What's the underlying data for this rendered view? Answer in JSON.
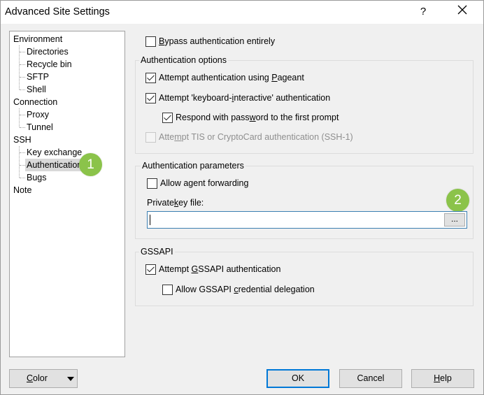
{
  "window": {
    "title": "Advanced Site Settings",
    "help_glyph": "?",
    "close_glyph": "close"
  },
  "tree": {
    "items": [
      {
        "label": "Environment"
      },
      {
        "label": "Directories"
      },
      {
        "label": "Recycle bin"
      },
      {
        "label": "SFTP"
      },
      {
        "label": "Shell"
      },
      {
        "label": "Connection"
      },
      {
        "label": "Proxy"
      },
      {
        "label": "Tunnel"
      },
      {
        "label": "SSH"
      },
      {
        "label": "Key exchange"
      },
      {
        "label": "Authentication",
        "selected": true
      },
      {
        "label": "Bugs"
      },
      {
        "label": "Note"
      }
    ]
  },
  "badges": {
    "one": "1",
    "two": "2",
    "color": "#8bc34a"
  },
  "bypass": {
    "label_u": "B",
    "label_rest": "ypass authentication entirely",
    "checked": false
  },
  "auth_options": {
    "title": "Authentication options",
    "pageant": {
      "pre": "Attempt authentication using ",
      "u": "P",
      "post": "ageant",
      "checked": true
    },
    "keyboard": {
      "pre": "Attempt 'keyboard-",
      "u": "i",
      "post": "nteractive' authentication",
      "checked": true
    },
    "respond": {
      "pre": "Respond with pass",
      "u": "w",
      "post": "ord to the first prompt",
      "checked": true
    },
    "tis": {
      "pre": "Atte",
      "u": "m",
      "post": "pt TIS or CryptoCard authentication (SSH-1)",
      "checked": false,
      "disabled": true
    }
  },
  "auth_params": {
    "title": "Authentication parameters",
    "agent": {
      "label": "Allow agent forwarding",
      "checked": false
    },
    "key_label": {
      "pre": "Private ",
      "u": "k",
      "post": "ey file:"
    },
    "key_value": "",
    "browse_label": "..."
  },
  "gssapi": {
    "title": "GSSAPI",
    "attempt": {
      "pre": "Attempt ",
      "u": "G",
      "post": "SSAPI authentication",
      "checked": true
    },
    "delegation": {
      "pre": "Allow GSSAPI ",
      "u": "c",
      "post": "redential delegation",
      "checked": false
    }
  },
  "buttons": {
    "color": {
      "u": "C",
      "rest": "olor"
    },
    "ok": "OK",
    "cancel": "Cancel",
    "help": {
      "u": "H",
      "rest": "elp"
    }
  },
  "colors": {
    "accent": "#0078d7",
    "badge": "#8bc34a"
  }
}
